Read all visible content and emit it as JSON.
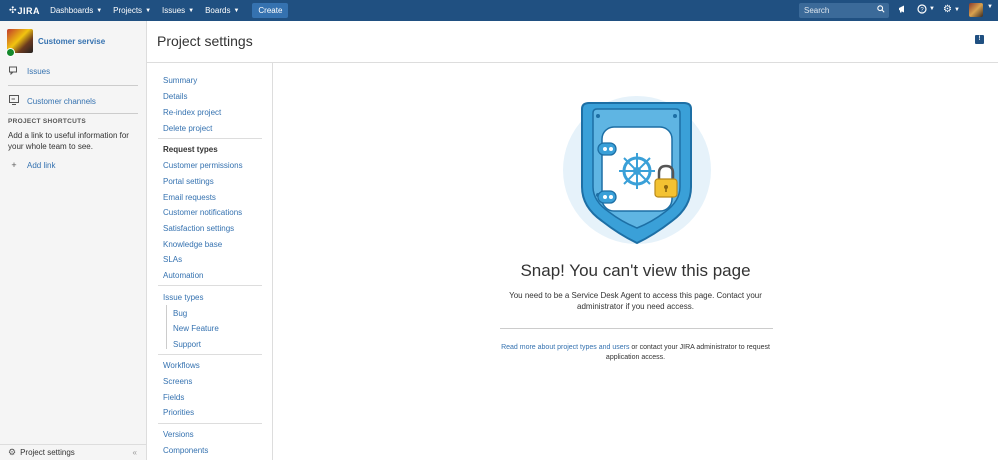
{
  "topbar": {
    "logo_text": "JIRA",
    "nav": [
      {
        "label": "Dashboards"
      },
      {
        "label": "Projects"
      },
      {
        "label": "Issues"
      },
      {
        "label": "Boards"
      }
    ],
    "create_label": "Create",
    "search_placeholder": "Search",
    "icons": [
      "notifications-megaphone-icon",
      "help-icon",
      "settings-gear-icon",
      "user-avatar"
    ]
  },
  "sidebar": {
    "project_name": "Customer servise",
    "items": [
      {
        "label": "Issues",
        "icon": "issues-icon"
      },
      {
        "label": "Customer channels",
        "icon": "customer-channels-icon"
      }
    ],
    "shortcuts_title": "PROJECT SHORTCUTS",
    "shortcuts_text": "Add a link to useful information for your whole team to see.",
    "add_link_label": "Add link",
    "footer_label": "Project settings",
    "collapse_glyph": "«"
  },
  "header": {
    "title": "Project settings"
  },
  "settings_nav": {
    "group1": [
      "Summary",
      "Details",
      "Re-index project",
      "Delete project"
    ],
    "request_types_heading": "Request types",
    "group2": [
      "Customer permissions",
      "Portal settings",
      "Email requests",
      "Customer notifications",
      "Satisfaction settings",
      "Knowledge base",
      "SLAs",
      "Automation"
    ],
    "issue_types": "Issue types",
    "issue_type_children": [
      "Bug",
      "New Feature",
      "Support"
    ],
    "group4": [
      "Workflows",
      "Screens",
      "Fields",
      "Priorities"
    ],
    "group5": [
      "Versions",
      "Components"
    ]
  },
  "main": {
    "title": "Snap! You can't view this page",
    "message_line1": "You need to be a Service Desk Agent to access this page. Contact your",
    "message_line2": "administrator if you need access.",
    "read_more_link": "Read more about project types and users",
    "read_more_rest": " or contact your JIRA administrator to request",
    "read_more_line2": "application access."
  },
  "colors": {
    "topbar": "#205081",
    "link": "#3572b0",
    "safe_blue": "#3aa0d8",
    "safe_circle": "#e6f2fa",
    "lock_yellow": "#f3c232"
  }
}
